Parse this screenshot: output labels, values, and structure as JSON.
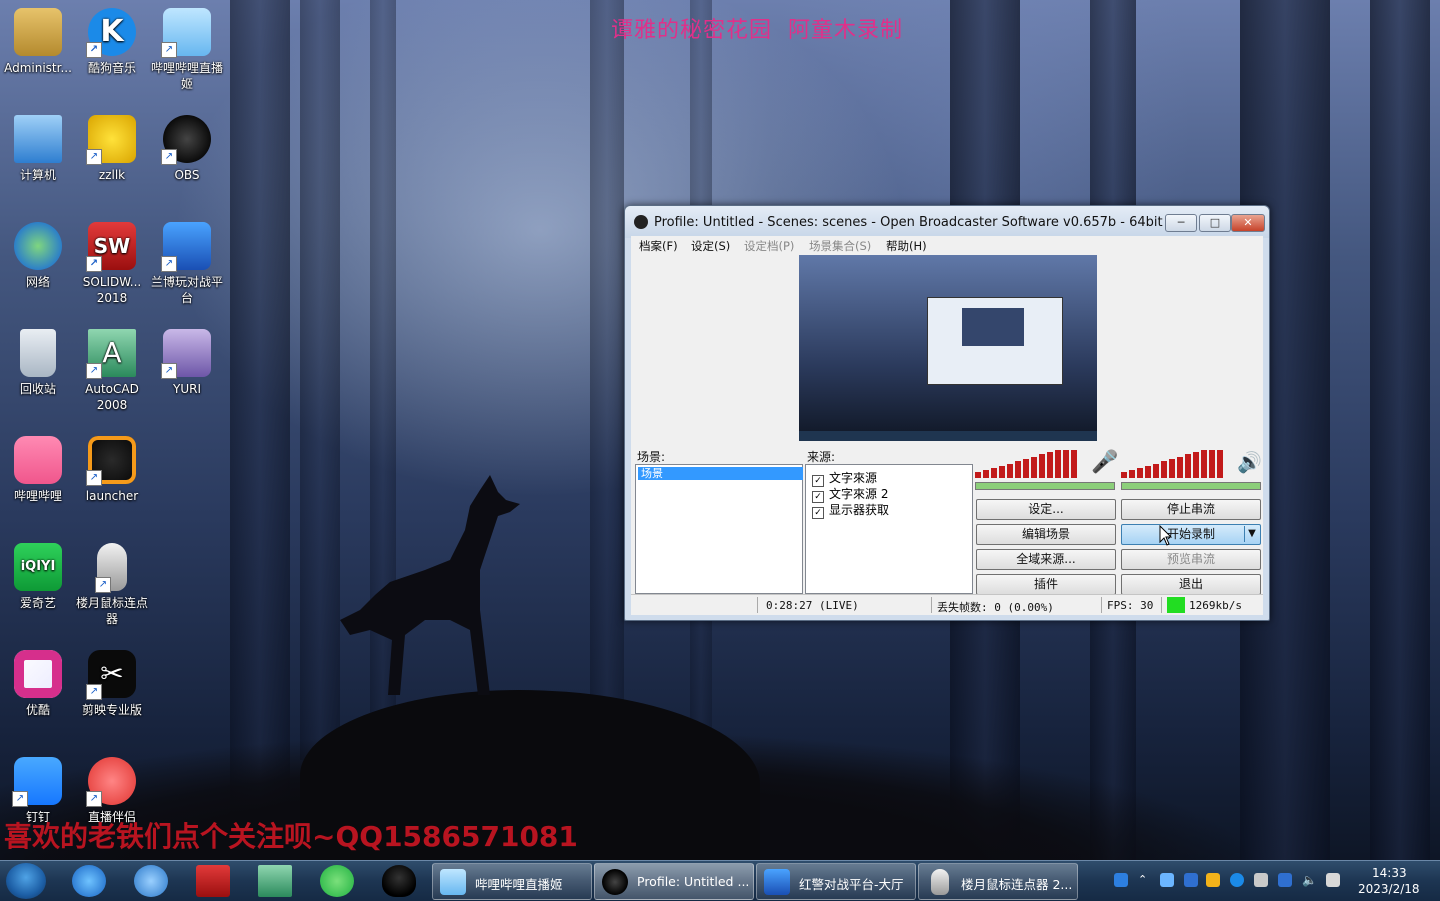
{
  "overlay": {
    "top_text": "谭雅的秘密花园  阿童木录制",
    "bottom_text": "喜欢的老铁们点个关注呗~QQ1586571081"
  },
  "desktop_icons": [
    {
      "label": "Administr...",
      "icon": "user-folder-icon"
    },
    {
      "label": "酷狗音乐",
      "icon": "kugou-music-icon"
    },
    {
      "label": "哔哩哔哩直播姬",
      "icon": "bilibili-live-icon"
    },
    {
      "label": "计算机",
      "icon": "computer-icon"
    },
    {
      "label": "zzllk",
      "icon": "pikachu-game-icon"
    },
    {
      "label": "OBS",
      "icon": "obs-icon"
    },
    {
      "label": "网络",
      "icon": "network-icon"
    },
    {
      "label": "SOLIDW... 2018",
      "icon": "solidworks-icon"
    },
    {
      "label": "兰博玩对战平台",
      "icon": "lanbo-platform-icon"
    },
    {
      "label": "回收站",
      "icon": "recycle-bin-icon"
    },
    {
      "label": "AutoCAD 2008",
      "icon": "autocad-icon"
    },
    {
      "label": "YURI",
      "icon": "yuri-icon"
    },
    {
      "label": "哔哩哔哩",
      "icon": "bilibili-icon"
    },
    {
      "label": "launcher",
      "icon": "launcher-icon"
    },
    {
      "label": "爱奇艺",
      "icon": "iqiyi-icon"
    },
    {
      "label": "楼月鼠标连点器",
      "icon": "mouse-clicker-icon"
    },
    {
      "label": "优酷",
      "icon": "youku-icon"
    },
    {
      "label": "剪映专业版",
      "icon": "capcut-icon"
    },
    {
      "label": "钉钉",
      "icon": "dingtalk-icon"
    },
    {
      "label": "直播伴侣",
      "icon": "live-companion-icon"
    }
  ],
  "obs": {
    "title": "Profile: Untitled - Scenes: scenes - Open Broadcaster Software v0.657b - 64bit",
    "menu": [
      {
        "label": "档案(F)",
        "enabled": true
      },
      {
        "label": "设定(S)",
        "enabled": true
      },
      {
        "label": "设定档(P)",
        "enabled": false
      },
      {
        "label": "场景集合(S)",
        "enabled": false
      },
      {
        "label": "帮助(H)",
        "enabled": true
      }
    ],
    "scenes_label": "场景:",
    "scenes": [
      "场景"
    ],
    "sources_label": "来源:",
    "sources": [
      {
        "label": "文字來源",
        "checked": true
      },
      {
        "label": "文字來源 2",
        "checked": true
      },
      {
        "label": "显示器获取",
        "checked": true
      }
    ],
    "buttons": {
      "settings": "设定...",
      "stop_stream": "停止串流",
      "edit_scene": "编辑场景",
      "start_record": "开始录制",
      "global_sources": "全域来源...",
      "preview_stream": "预览串流",
      "plugins": "插件",
      "exit": "退出"
    },
    "status": {
      "time": "0:28:27 (LIVE)",
      "dropped": "丢失帧数: 0 (0.00%)",
      "fps": "FPS: 30",
      "bitrate": "1269kb/s",
      "bitrate_color": "#22dd22"
    },
    "icons": {
      "mic": "microphone-icon",
      "speaker": "speaker-icon"
    }
  },
  "taskbar": {
    "pinned": [
      "ie-icon",
      "browser-icon",
      "solidworks-icon",
      "autocad-icon",
      "wechat-icon",
      "qq-icon"
    ],
    "tasks": [
      {
        "label": "哔哩哔哩直播姬",
        "active": false
      },
      {
        "label": "Profile: Untitled ...",
        "active": true
      },
      {
        "label": "红警对战平台-大厅",
        "active": false
      },
      {
        "label": "楼月鼠标连点器 2...",
        "active": false
      }
    ],
    "clock_time": "14:33",
    "clock_date": "2023/2/18"
  }
}
